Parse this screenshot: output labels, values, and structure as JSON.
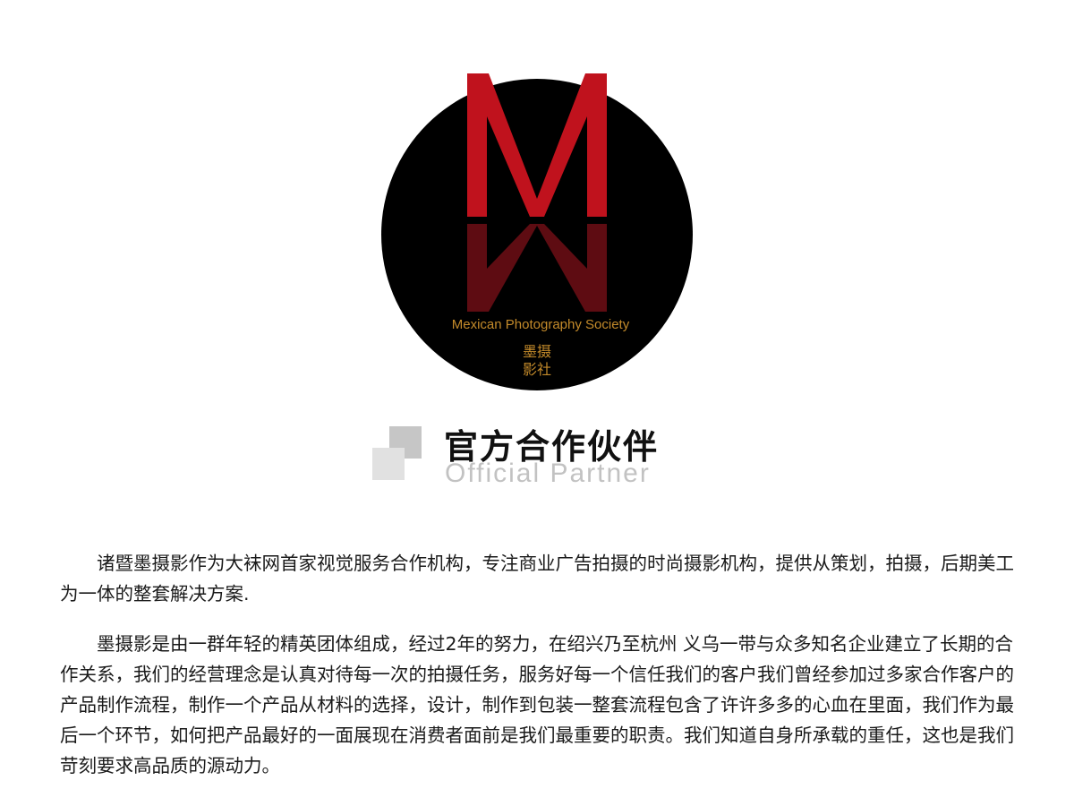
{
  "logo": {
    "monogram": "M",
    "english_name": "Mexican Photography Society",
    "chinese_name": [
      "墨摄",
      "影社"
    ],
    "colors": {
      "circle": "#000000",
      "m_top": "#c0121d",
      "m_reflection": "#5e0c12",
      "text": "#c38a2a"
    }
  },
  "heading": {
    "title_cn": "官方合作伙伴",
    "title_en": "Official Partner"
  },
  "paragraphs": [
    "诸暨墨摄影作为大袜网首家视觉服务合作机构，专注商业广告拍摄的时尚摄影机构，提供从策划，拍摄，后期美工为一体的整套解决方案.",
    "墨摄影是由一群年轻的精英团体组成，经过2年的努力，在绍兴乃至杭州 义乌一带与众多知名企业建立了长期的合作关系，我们的经营理念是认真对待每一次的拍摄任务，服务好每一个信任我们的客户我们曾经参加过多家合作客户的产品制作流程，制作一个产品从材料的选择，设计，制作到包装一整套流程包含了许许多多的心血在里面，我们作为最后一个环节，如何把产品最好的一面展现在消费者面前是我们最重要的职责。我们知道自身所承载的重任，这也是我们苛刻要求高品质的源动力。"
  ]
}
